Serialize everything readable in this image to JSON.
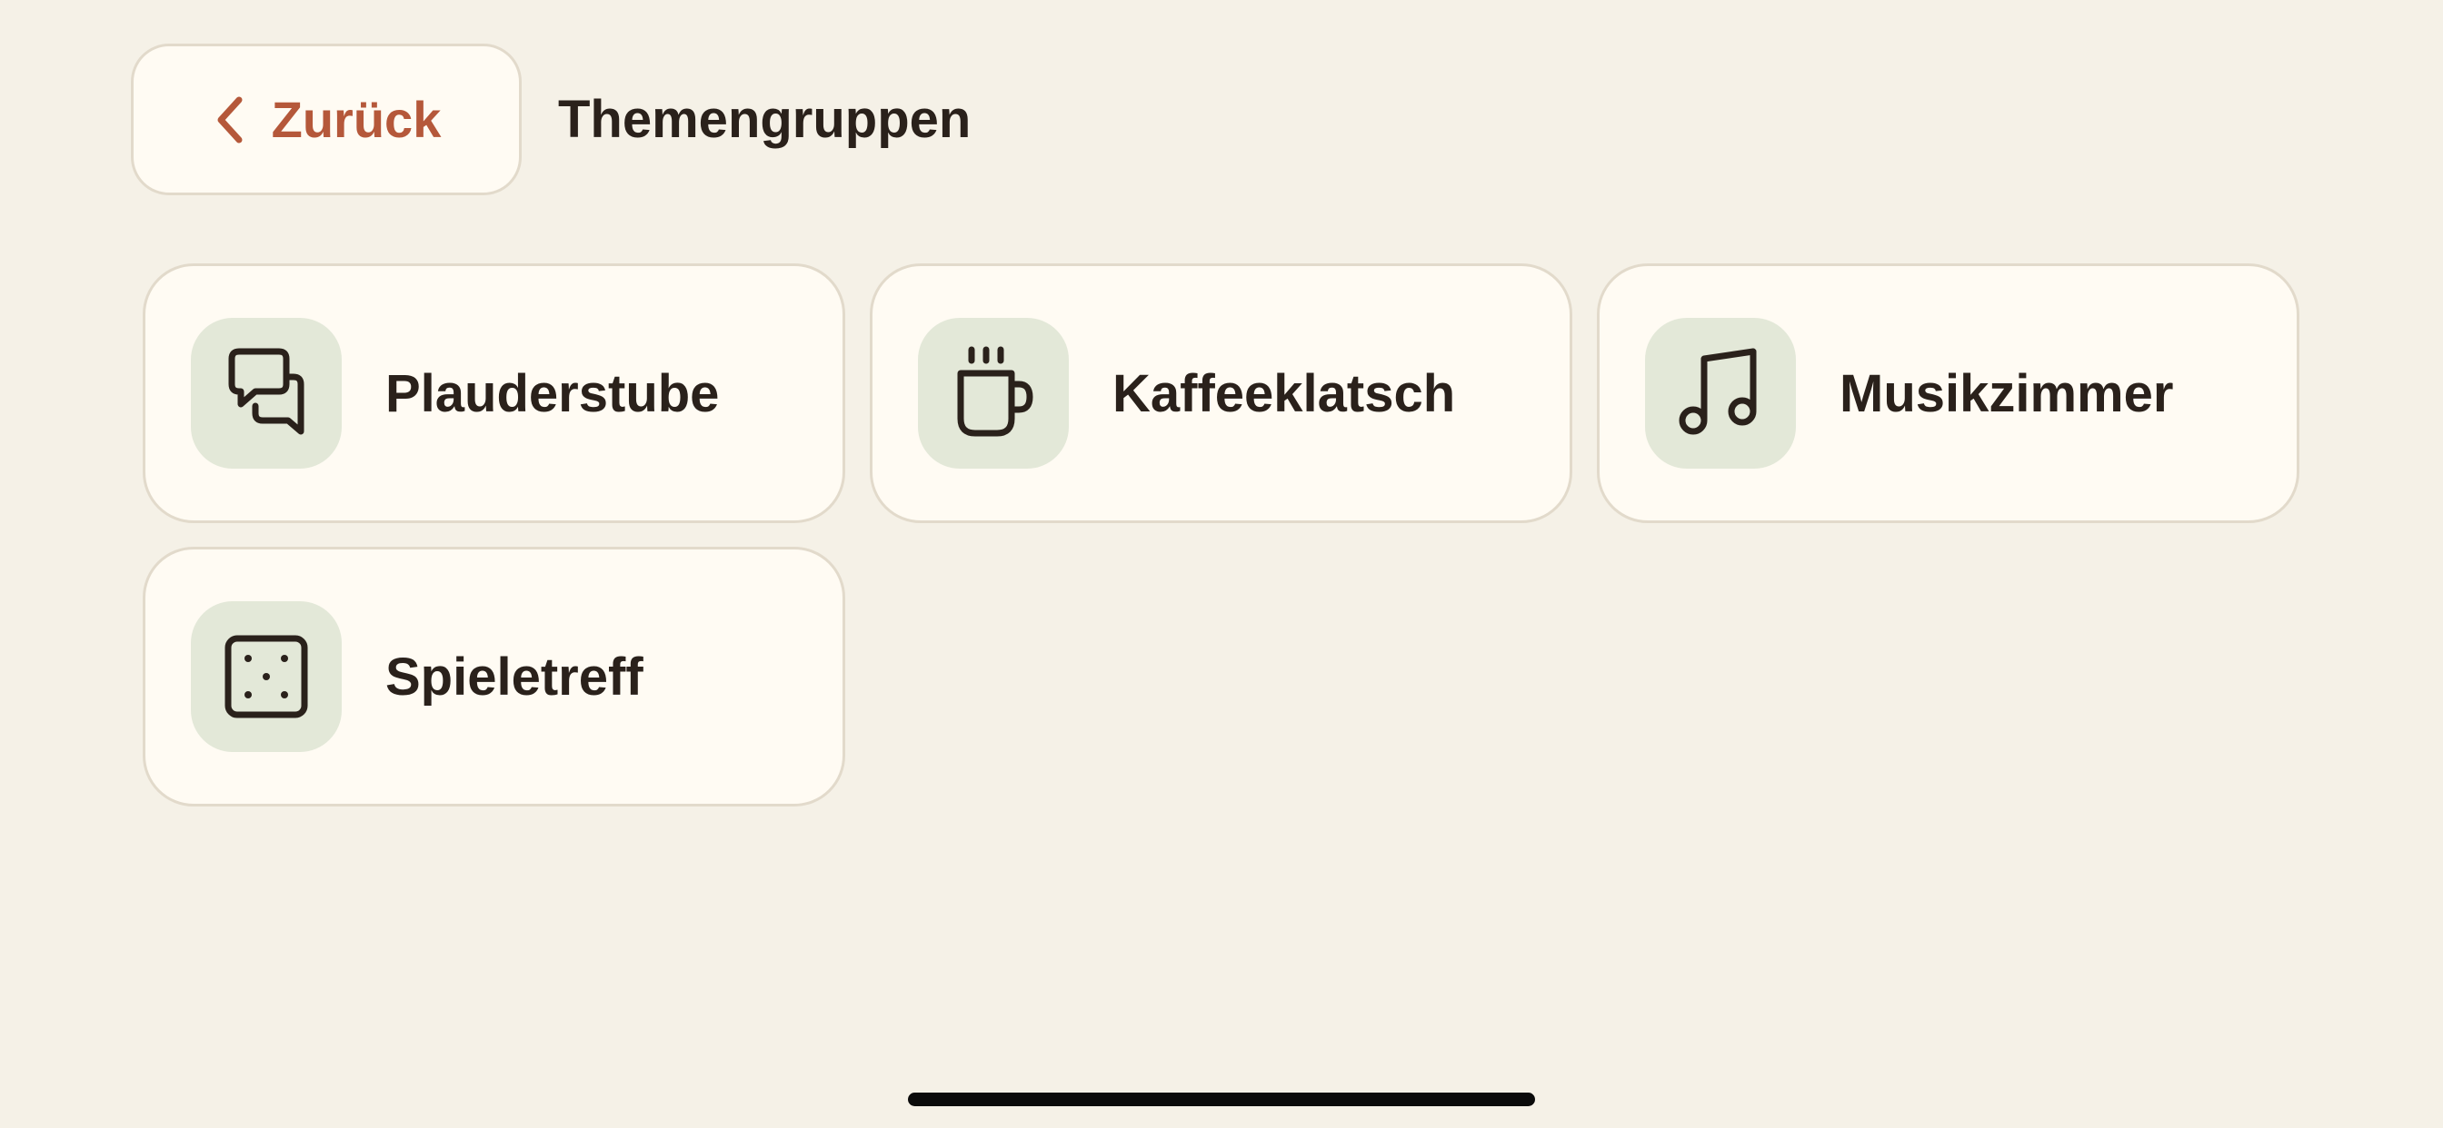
{
  "header": {
    "back_label": "Zurück",
    "title": "Themengruppen"
  },
  "groups": [
    {
      "label": "Plauderstube",
      "icon": "chat-bubbles-icon"
    },
    {
      "label": "Kaffeeklatsch",
      "icon": "coffee-cup-icon"
    },
    {
      "label": "Musikzimmer",
      "icon": "music-note-icon"
    },
    {
      "label": "Spieletreff",
      "icon": "dice-icon"
    }
  ],
  "colors": {
    "background": "#F5F1E7",
    "card": "#FFFBF3",
    "border": "#E2DACB",
    "icon_tile": "#E3E8D8",
    "accent": "#B5583A",
    "text": "#2A211B"
  }
}
